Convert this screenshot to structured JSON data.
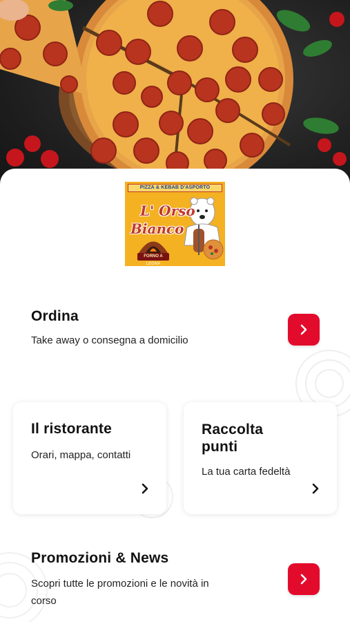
{
  "hero": {
    "image": "pepperoni-pizza-photo"
  },
  "logo": {
    "banner": "PIZZA & KEBAB D'ASPORTO",
    "name_line1": "L' Orso",
    "name_line2": "Bianco",
    "oven_label": "FORNO A LEGNA"
  },
  "order": {
    "title": "Ordina",
    "subtitle": "Take away o consegna a domicilio",
    "icon": "chevron-right-icon"
  },
  "restaurant": {
    "title": "Il ristorante",
    "subtitle": "Orari, mappa, contatti",
    "icon": "chevron-right-icon"
  },
  "points": {
    "title_line1": "Raccolta",
    "title_line2": "punti",
    "subtitle": "La tua carta fedeltà",
    "icon": "chevron-right-icon"
  },
  "news": {
    "title": "Promozioni & News",
    "subtitle_line1": "Scopri tutte le promozioni e le novità in",
    "subtitle_line2": "corso",
    "icon": "chevron-right-icon"
  },
  "colors": {
    "accent": "#e30b2c",
    "logo_background": "#f4b121",
    "logo_text": "#c0392b",
    "text": "#111111"
  }
}
